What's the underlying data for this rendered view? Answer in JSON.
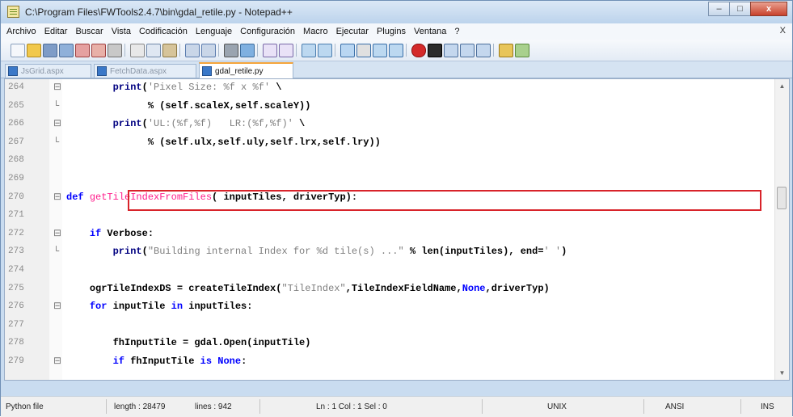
{
  "window": {
    "title": "C:\\Program Files\\FWTools2.4.7\\bin\\gdal_retile.py - Notepad++",
    "minimize": "–",
    "maximize": "□",
    "close": "x"
  },
  "menu": {
    "items": [
      "Archivo",
      "Editar",
      "Buscar",
      "Vista",
      "Codificación",
      "Lenguaje",
      "Configuración",
      "Macro",
      "Ejecutar",
      "Plugins",
      "Ventana",
      "?"
    ],
    "close": "X"
  },
  "tabs": [
    {
      "label": "JsGrid.aspx",
      "active": false
    },
    {
      "label": "FetchData.aspx",
      "active": false
    },
    {
      "label": "gdal_retile.py",
      "active": true
    }
  ],
  "editor": {
    "lines": [
      {
        "num": "264",
        "fold": "⊟",
        "indent": "        ",
        "segments": [
          [
            "nm",
            "print"
          ],
          [
            "op",
            "("
          ],
          [
            "st",
            "'Pixel Size: %f x %f'"
          ],
          [
            "op",
            " \\"
          ]
        ]
      },
      {
        "num": "265",
        "fold": "└",
        "indent": "              ",
        "segments": [
          [
            "op",
            "% (self.scaleX,self.scaleY))"
          ]
        ]
      },
      {
        "num": "266",
        "fold": "⊟",
        "indent": "        ",
        "segments": [
          [
            "nm",
            "print"
          ],
          [
            "op",
            "("
          ],
          [
            "st",
            "'UL:(%f,%f)   LR:(%f,%f)'"
          ],
          [
            "op",
            " \\"
          ]
        ]
      },
      {
        "num": "267",
        "fold": "└",
        "indent": "              ",
        "segments": [
          [
            "op",
            "% (self.ulx,self.uly,self.lrx,self.lry))"
          ]
        ]
      },
      {
        "num": "268",
        "fold": "",
        "indent": "",
        "segments": []
      },
      {
        "num": "269",
        "fold": "",
        "indent": "",
        "segments": []
      },
      {
        "num": "270",
        "fold": "⊟",
        "indent": "",
        "segments": [
          [
            "kw",
            "def"
          ],
          [
            "op",
            " "
          ],
          [
            "fn",
            "getTileIndexFromFiles"
          ],
          [
            "op",
            "( inputTiles, driverTyp):"
          ]
        ]
      },
      {
        "num": "271",
        "fold": "",
        "indent": "",
        "segments": []
      },
      {
        "num": "272",
        "fold": "⊟",
        "indent": "    ",
        "segments": [
          [
            "kw",
            "if"
          ],
          [
            "op",
            " Verbose:"
          ]
        ]
      },
      {
        "num": "273",
        "fold": "└",
        "indent": "        ",
        "segments": [
          [
            "nm",
            "print"
          ],
          [
            "op",
            "("
          ],
          [
            "st",
            "\"Building internal Index for %d tile(s) ...\""
          ],
          [
            "op",
            " % len(inputTiles), end="
          ],
          [
            "st",
            "' '"
          ],
          [
            "op",
            ")"
          ]
        ]
      },
      {
        "num": "274",
        "fold": "",
        "indent": "",
        "segments": []
      },
      {
        "num": "275",
        "fold": "",
        "indent": "    ",
        "segments": [
          [
            "op",
            "ogrTileIndexDS = createTileIndex("
          ],
          [
            "st",
            "\"TileIndex\""
          ],
          [
            "op",
            ",TileIndexFieldName,"
          ],
          [
            "kw",
            "None"
          ],
          [
            "op",
            ",driverTyp)"
          ]
        ]
      },
      {
        "num": "276",
        "fold": "⊟",
        "indent": "    ",
        "segments": [
          [
            "kw",
            "for"
          ],
          [
            "op",
            " inputTile "
          ],
          [
            "kw",
            "in"
          ],
          [
            "op",
            " inputTiles:"
          ]
        ]
      },
      {
        "num": "277",
        "fold": "",
        "indent": "",
        "segments": []
      },
      {
        "num": "278",
        "fold": "",
        "indent": "        ",
        "segments": [
          [
            "op",
            "fhInputTile = gdal.Open(inputTile)"
          ]
        ]
      },
      {
        "num": "279",
        "fold": "⊟",
        "indent": "        ",
        "segments": [
          [
            "kw",
            "if"
          ],
          [
            "op",
            " fhInputTile "
          ],
          [
            "kw",
            "is"
          ],
          [
            "op",
            " "
          ],
          [
            "kw",
            "None"
          ],
          [
            "op",
            ":"
          ]
        ]
      }
    ]
  },
  "status": {
    "file_type": "Python file",
    "length": "length : 28479",
    "lines": "lines : 942",
    "position": "Ln : 1   Col : 1   Sel : 0",
    "eol": "UNIX",
    "encoding": "ANSI",
    "mode": "INS"
  }
}
